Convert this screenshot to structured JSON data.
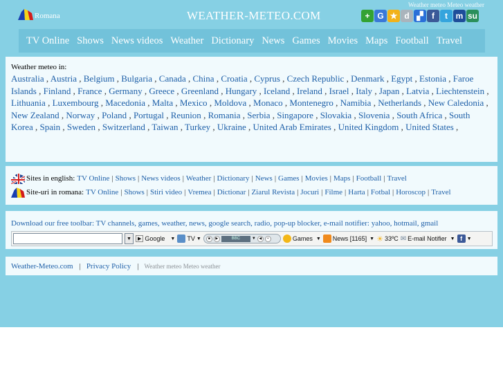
{
  "header": {
    "tagline": "Weather meteo Meteo weather",
    "lang_label": "Romana",
    "logo": "WEATHER-METEO.COM",
    "share_icons": [
      {
        "name": "add-icon",
        "glyph": "+",
        "color": "#34a233"
      },
      {
        "name": "google-icon",
        "glyph": "G",
        "color": "#3a78d8"
      },
      {
        "name": "star-icon",
        "glyph": "★",
        "color": "#f2b21a"
      },
      {
        "name": "digg-icon",
        "glyph": "d",
        "color": "#aab4bc"
      },
      {
        "name": "delicious-icon",
        "glyph": "▞",
        "color": "#2a6fd8"
      },
      {
        "name": "facebook-icon",
        "glyph": "f",
        "color": "#3b5998"
      },
      {
        "name": "twitter-icon",
        "glyph": "t",
        "color": "#35a4dd"
      },
      {
        "name": "myspace-icon",
        "glyph": "m",
        "color": "#1e4d9a"
      },
      {
        "name": "stumbleupon-icon",
        "glyph": "su",
        "color": "#2a8f5a"
      }
    ]
  },
  "nav": [
    "TV Online",
    "Shows",
    "News videos",
    "Weather",
    "Dictionary",
    "News",
    "Games",
    "Movies",
    "Maps",
    "Football",
    "Travel"
  ],
  "countries": {
    "heading": "Weather meteo in:",
    "list": [
      "Australia",
      "Austria",
      "Belgium",
      "Bulgaria",
      "Canada",
      "China",
      "Croatia",
      "Cyprus",
      "Czech Republic",
      "Denmark",
      "Egypt",
      "Estonia",
      "Faroe Islands",
      "Finland",
      "France",
      "Germany",
      "Greece",
      "Greenland",
      "Hungary",
      "Iceland",
      "Ireland",
      "Israel",
      "Italy",
      "Japan",
      "Latvia",
      "Liechtenstein",
      "Lithuania",
      "Luxembourg",
      "Macedonia",
      "Malta",
      "Mexico",
      "Moldova",
      "Monaco",
      "Montenegro",
      "Namibia",
      "Netherlands",
      "New Caledonia",
      "New Zealand",
      "Norway",
      "Poland",
      "Portugal",
      "Reunion",
      "Romania",
      "Serbia",
      "Singapore",
      "Slovakia",
      "Slovenia",
      "South Africa",
      "South Korea",
      "Spain",
      "Sweden",
      "Switzerland",
      "Taiwan",
      "Turkey",
      "Ukraine",
      "United Arab Emirates",
      "United Kingdom",
      "United States"
    ]
  },
  "sites": {
    "english_label": "Sites in english:",
    "english_links": [
      "TV Online",
      "Shows",
      "News videos",
      "Weather",
      "Dictionary",
      "News",
      "Games",
      "Movies",
      "Maps",
      "Football",
      "Travel"
    ],
    "romanian_label": "Site-uri in romana:",
    "romanian_links": [
      "TV Online",
      "Shows",
      "Stiri video",
      "Vremea",
      "Dictionar",
      "Ziarul Revista",
      "Jocuri",
      "Filme",
      "Harta",
      "Fotbal",
      "Horoscop",
      "Travel"
    ]
  },
  "toolbar": {
    "promo": "Download our free toolbar: TV channels, games, weather, news, google search, radio, pop-up blocker, e-mail notifier: yahoo, hotmail, gmail",
    "search_label": "Google",
    "tv_label": "TV",
    "radio_station": "BBC",
    "games_label": "Games",
    "news_label": "News [1165]",
    "temp_label": "33ºC",
    "email_label": "E-mail Notifier"
  },
  "footer": {
    "site_link": "Weather-Meteo.com",
    "privacy_link": "Privacy Policy",
    "tagline": "Weather meteo Meteo weather"
  },
  "colors": {
    "page_bg": "#86d0e4",
    "nav_bg": "#72c2da",
    "box_bg": "#f1fafd",
    "link": "#1d5fa8"
  }
}
